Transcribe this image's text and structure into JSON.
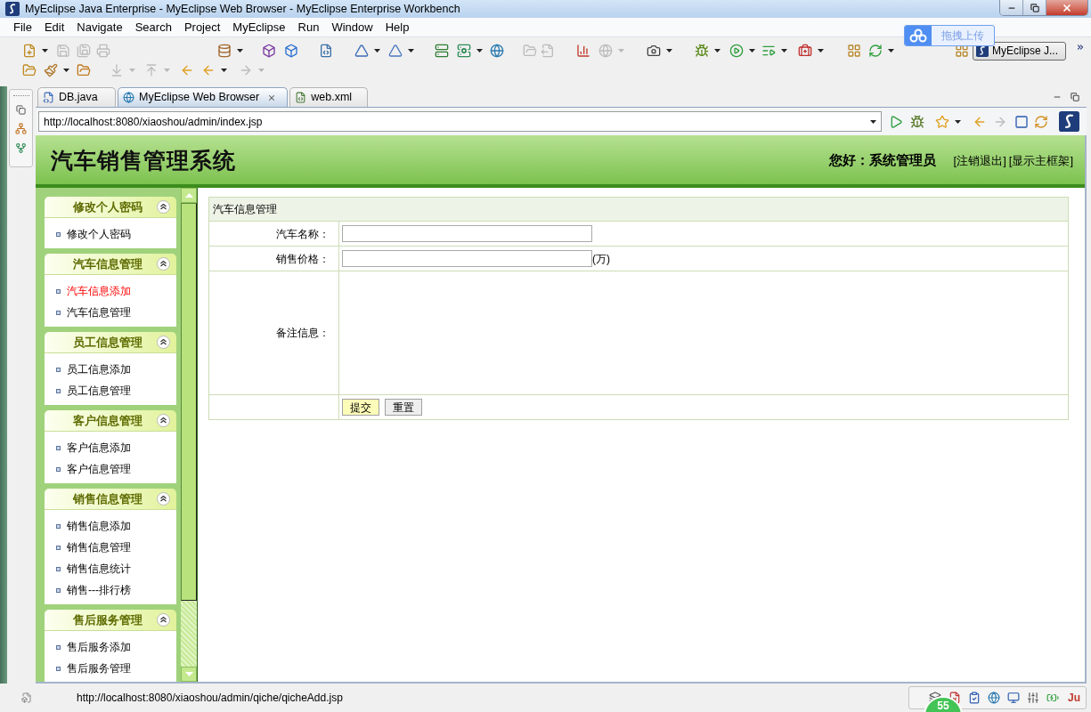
{
  "window": {
    "title": "MyEclipse Java Enterprise - MyEclipse Web Browser - MyEclipse Enterprise Workbench"
  },
  "menu": [
    "File",
    "Edit",
    "Navigate",
    "Search",
    "Project",
    "MyEclipse",
    "Run",
    "Window",
    "Help"
  ],
  "toolbar": {
    "row_1": [
      {
        "disabled": false,
        "dropdown": true
      },
      {
        "disabled": true,
        "dropdown": false
      },
      {
        "disabled": true,
        "dropdown": false
      },
      {
        "disabled": true,
        "dropdown": false
      },
      {
        "disabled": false,
        "dropdown": true
      },
      {
        "disabled": false,
        "dropdown": false
      },
      {
        "disabled": false,
        "dropdown": false
      },
      {
        "disabled": false,
        "dropdown": false
      },
      {
        "disabled": false,
        "dropdown": true
      },
      {
        "disabled": false,
        "dropdown": true
      },
      {
        "disabled": false,
        "dropdown": false
      },
      {
        "disabled": false,
        "dropdown": true
      },
      {
        "disabled": false,
        "dropdown": false
      },
      {
        "disabled": true,
        "dropdown": false
      },
      {
        "disabled": true,
        "dropdown": false
      },
      {
        "disabled": false,
        "dropdown": false
      },
      {
        "disabled": true,
        "dropdown": true
      },
      {
        "disabled": false,
        "dropdown": true
      },
      {
        "disabled": false,
        "dropdown": true
      },
      {
        "disabled": false,
        "dropdown": true
      },
      {
        "disabled": false,
        "dropdown": true
      },
      {
        "disabled": false,
        "dropdown": true
      },
      {
        "disabled": false,
        "dropdown": false
      },
      {
        "disabled": false,
        "dropdown": true
      }
    ],
    "row_2": [
      {
        "disabled": false,
        "dropdown": false
      },
      {
        "disabled": false,
        "dropdown": true
      },
      {
        "disabled": false,
        "dropdown": false
      },
      {
        "disabled": true,
        "dropdown": true
      },
      {
        "disabled": true,
        "dropdown": true
      },
      {
        "disabled": false,
        "dropdown": false
      },
      {
        "disabled": false,
        "dropdown": true
      },
      {
        "disabled": true,
        "dropdown": true
      }
    ]
  },
  "upload_popup": {
    "label": "拖拽上传"
  },
  "perspective": {
    "label": "MyEclipse J..."
  },
  "editor_tabs": [
    {
      "label": "DB.java",
      "selected": false
    },
    {
      "label": "MyEclipse Web Browser",
      "selected": true
    },
    {
      "label": "web.xml",
      "selected": false
    }
  ],
  "browser": {
    "url": "http://localhost:8080/xiaoshou/admin/index.jsp",
    "buttons": [
      {
        "disabled": false,
        "dropdown": false
      },
      {
        "disabled": false,
        "dropdown": false
      },
      {
        "disabled": false,
        "dropdown": true
      },
      {
        "disabled": false,
        "dropdown": false
      },
      {
        "disabled": true,
        "dropdown": false
      },
      {
        "disabled": false,
        "dropdown": false
      },
      {
        "disabled": false,
        "dropdown": false
      }
    ]
  },
  "page": {
    "header": {
      "title": "汽车销售管理系统",
      "greeting": "您好：系统管理员",
      "links": [
        "[注销退出]",
        "[显示主框架]"
      ]
    },
    "sidebar": {
      "panels": [
        {
          "title": "修改个人密码",
          "expanded": true,
          "items": [
            {
              "label": "修改个人密码",
              "selected": false
            }
          ]
        },
        {
          "title": "汽车信息管理",
          "expanded": true,
          "items": [
            {
              "label": "汽车信息添加",
              "selected": true
            },
            {
              "label": "汽车信息管理",
              "selected": false
            }
          ]
        },
        {
          "title": "员工信息管理",
          "expanded": true,
          "items": [
            {
              "label": "员工信息添加",
              "selected": false
            },
            {
              "label": "员工信息管理",
              "selected": false
            }
          ]
        },
        {
          "title": "客户信息管理",
          "expanded": true,
          "items": [
            {
              "label": "客户信息添加",
              "selected": false
            },
            {
              "label": "客户信息管理",
              "selected": false
            }
          ]
        },
        {
          "title": "销售信息管理",
          "expanded": true,
          "items": [
            {
              "label": "销售信息添加",
              "selected": false
            },
            {
              "label": "销售信息管理",
              "selected": false
            },
            {
              "label": "销售信息统计",
              "selected": false
            },
            {
              "label": "销售---排行榜",
              "selected": false
            }
          ]
        },
        {
          "title": "售后服务管理",
          "expanded": true,
          "items": [
            {
              "label": "售后服务添加",
              "selected": false
            },
            {
              "label": "售后服务管理",
              "selected": false
            }
          ]
        }
      ]
    },
    "form": {
      "title": "汽车信息管理",
      "fields": [
        {
          "label": "汽车名称：",
          "kind": "input"
        },
        {
          "label": "销售价格：",
          "kind": "input",
          "unit": "(万)"
        },
        {
          "label": "备注信息：",
          "kind": "note"
        }
      ],
      "buttons": [
        {
          "label": "提交",
          "highlighted": true
        },
        {
          "label": "重置",
          "highlighted": false
        }
      ]
    }
  },
  "status_bar": {
    "url": "http://localhost:8080/xiaoshou/admin/qiche/qicheAdd.jsp",
    "tray_label": "Ju",
    "badge": "55"
  }
}
